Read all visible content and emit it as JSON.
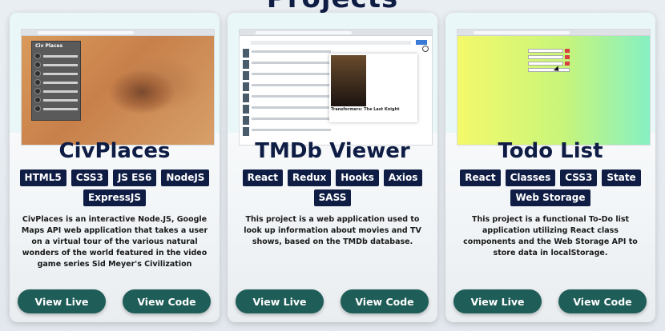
{
  "page": {
    "heading": "Projects"
  },
  "projects": [
    {
      "title": "CivPlaces",
      "shot_panel_title": "Civ Places",
      "tags": [
        "HTML5",
        "CSS3",
        "JS ES6",
        "NodeJS",
        "ExpressJS"
      ],
      "description": "CivPlaces is an interactive Node.JS, Google Maps API web application that takes a user on a virtual tour of the various natural wonders of the world featured in the video game series Sid Meyer's Civilization",
      "live_label": "View Live",
      "code_label": "View Code"
    },
    {
      "title": "TMDb Viewer",
      "shot_modal_title": "Transformers: The Last Knight",
      "tags": [
        "React",
        "Redux",
        "Hooks",
        "Axios",
        "SASS"
      ],
      "description": "This project is a web application used to look up information about movies and TV shows, based on the TMDb database.",
      "live_label": "View Live",
      "code_label": "View Code"
    },
    {
      "title": "Todo List",
      "tags": [
        "React",
        "Classes",
        "CSS3",
        "State",
        "Web Storage"
      ],
      "description": "This project is a functional To-Do list application utilizing React class components and the Web Storage API to store data in localStorage.",
      "live_label": "View Live",
      "code_label": "View Code"
    }
  ],
  "colors": {
    "navy": "#0f1d45",
    "button_teal": "#1f5d58",
    "card_bg": "#ffffff"
  }
}
